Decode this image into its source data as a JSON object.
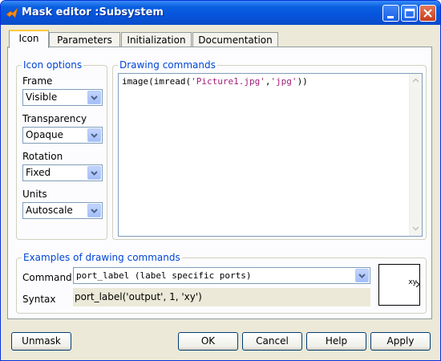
{
  "window": {
    "title": "Mask editor :Subsystem",
    "icon": "matlab-icon"
  },
  "tabs": [
    {
      "label": "Icon",
      "active": true
    },
    {
      "label": "Parameters",
      "active": false
    },
    {
      "label": "Initialization",
      "active": false
    },
    {
      "label": "Documentation",
      "active": false
    }
  ],
  "icon_options": {
    "title": "Icon options",
    "frame": {
      "label": "Frame",
      "value": "Visible"
    },
    "transparency": {
      "label": "Transparency",
      "value": "Opaque"
    },
    "rotation": {
      "label": "Rotation",
      "value": "Fixed"
    },
    "units": {
      "label": "Units",
      "value": "Autoscale"
    }
  },
  "drawing_commands": {
    "title": "Drawing commands",
    "code_prefix": "image(imread(",
    "arg1": "'Picture1.jpg'",
    "comma": ",",
    "arg2": "'jpg'",
    "code_suffix": "))"
  },
  "examples": {
    "title": "Examples of drawing commands",
    "command_label": "Command",
    "command_value": "port_label (label specific ports)",
    "syntax_label": "Syntax",
    "syntax_value": "port_label('output', 1, 'xy')",
    "preview_text": "xy"
  },
  "buttons": {
    "unmask": "Unmask",
    "ok": "OK",
    "cancel": "Cancel",
    "help": "Help",
    "apply": "Apply"
  }
}
